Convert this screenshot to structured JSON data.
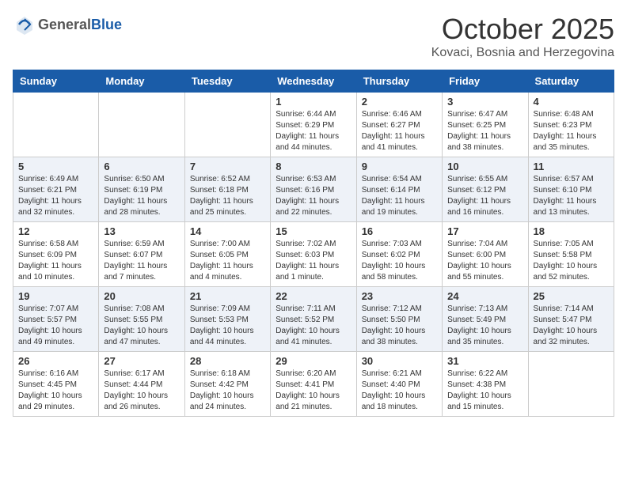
{
  "header": {
    "logo_general": "General",
    "logo_blue": "Blue",
    "month": "October 2025",
    "location": "Kovaci, Bosnia and Herzegovina"
  },
  "days_of_week": [
    "Sunday",
    "Monday",
    "Tuesday",
    "Wednesday",
    "Thursday",
    "Friday",
    "Saturday"
  ],
  "weeks": [
    [
      {
        "num": "",
        "info": ""
      },
      {
        "num": "",
        "info": ""
      },
      {
        "num": "",
        "info": ""
      },
      {
        "num": "1",
        "info": "Sunrise: 6:44 AM\nSunset: 6:29 PM\nDaylight: 11 hours\nand 44 minutes."
      },
      {
        "num": "2",
        "info": "Sunrise: 6:46 AM\nSunset: 6:27 PM\nDaylight: 11 hours\nand 41 minutes."
      },
      {
        "num": "3",
        "info": "Sunrise: 6:47 AM\nSunset: 6:25 PM\nDaylight: 11 hours\nand 38 minutes."
      },
      {
        "num": "4",
        "info": "Sunrise: 6:48 AM\nSunset: 6:23 PM\nDaylight: 11 hours\nand 35 minutes."
      }
    ],
    [
      {
        "num": "5",
        "info": "Sunrise: 6:49 AM\nSunset: 6:21 PM\nDaylight: 11 hours\nand 32 minutes."
      },
      {
        "num": "6",
        "info": "Sunrise: 6:50 AM\nSunset: 6:19 PM\nDaylight: 11 hours\nand 28 minutes."
      },
      {
        "num": "7",
        "info": "Sunrise: 6:52 AM\nSunset: 6:18 PM\nDaylight: 11 hours\nand 25 minutes."
      },
      {
        "num": "8",
        "info": "Sunrise: 6:53 AM\nSunset: 6:16 PM\nDaylight: 11 hours\nand 22 minutes."
      },
      {
        "num": "9",
        "info": "Sunrise: 6:54 AM\nSunset: 6:14 PM\nDaylight: 11 hours\nand 19 minutes."
      },
      {
        "num": "10",
        "info": "Sunrise: 6:55 AM\nSunset: 6:12 PM\nDaylight: 11 hours\nand 16 minutes."
      },
      {
        "num": "11",
        "info": "Sunrise: 6:57 AM\nSunset: 6:10 PM\nDaylight: 11 hours\nand 13 minutes."
      }
    ],
    [
      {
        "num": "12",
        "info": "Sunrise: 6:58 AM\nSunset: 6:09 PM\nDaylight: 11 hours\nand 10 minutes."
      },
      {
        "num": "13",
        "info": "Sunrise: 6:59 AM\nSunset: 6:07 PM\nDaylight: 11 hours\nand 7 minutes."
      },
      {
        "num": "14",
        "info": "Sunrise: 7:00 AM\nSunset: 6:05 PM\nDaylight: 11 hours\nand 4 minutes."
      },
      {
        "num": "15",
        "info": "Sunrise: 7:02 AM\nSunset: 6:03 PM\nDaylight: 11 hours\nand 1 minute."
      },
      {
        "num": "16",
        "info": "Sunrise: 7:03 AM\nSunset: 6:02 PM\nDaylight: 10 hours\nand 58 minutes."
      },
      {
        "num": "17",
        "info": "Sunrise: 7:04 AM\nSunset: 6:00 PM\nDaylight: 10 hours\nand 55 minutes."
      },
      {
        "num": "18",
        "info": "Sunrise: 7:05 AM\nSunset: 5:58 PM\nDaylight: 10 hours\nand 52 minutes."
      }
    ],
    [
      {
        "num": "19",
        "info": "Sunrise: 7:07 AM\nSunset: 5:57 PM\nDaylight: 10 hours\nand 49 minutes."
      },
      {
        "num": "20",
        "info": "Sunrise: 7:08 AM\nSunset: 5:55 PM\nDaylight: 10 hours\nand 47 minutes."
      },
      {
        "num": "21",
        "info": "Sunrise: 7:09 AM\nSunset: 5:53 PM\nDaylight: 10 hours\nand 44 minutes."
      },
      {
        "num": "22",
        "info": "Sunrise: 7:11 AM\nSunset: 5:52 PM\nDaylight: 10 hours\nand 41 minutes."
      },
      {
        "num": "23",
        "info": "Sunrise: 7:12 AM\nSunset: 5:50 PM\nDaylight: 10 hours\nand 38 minutes."
      },
      {
        "num": "24",
        "info": "Sunrise: 7:13 AM\nSunset: 5:49 PM\nDaylight: 10 hours\nand 35 minutes."
      },
      {
        "num": "25",
        "info": "Sunrise: 7:14 AM\nSunset: 5:47 PM\nDaylight: 10 hours\nand 32 minutes."
      }
    ],
    [
      {
        "num": "26",
        "info": "Sunrise: 6:16 AM\nSunset: 4:45 PM\nDaylight: 10 hours\nand 29 minutes."
      },
      {
        "num": "27",
        "info": "Sunrise: 6:17 AM\nSunset: 4:44 PM\nDaylight: 10 hours\nand 26 minutes."
      },
      {
        "num": "28",
        "info": "Sunrise: 6:18 AM\nSunset: 4:42 PM\nDaylight: 10 hours\nand 24 minutes."
      },
      {
        "num": "29",
        "info": "Sunrise: 6:20 AM\nSunset: 4:41 PM\nDaylight: 10 hours\nand 21 minutes."
      },
      {
        "num": "30",
        "info": "Sunrise: 6:21 AM\nSunset: 4:40 PM\nDaylight: 10 hours\nand 18 minutes."
      },
      {
        "num": "31",
        "info": "Sunrise: 6:22 AM\nSunset: 4:38 PM\nDaylight: 10 hours\nand 15 minutes."
      },
      {
        "num": "",
        "info": ""
      }
    ]
  ]
}
